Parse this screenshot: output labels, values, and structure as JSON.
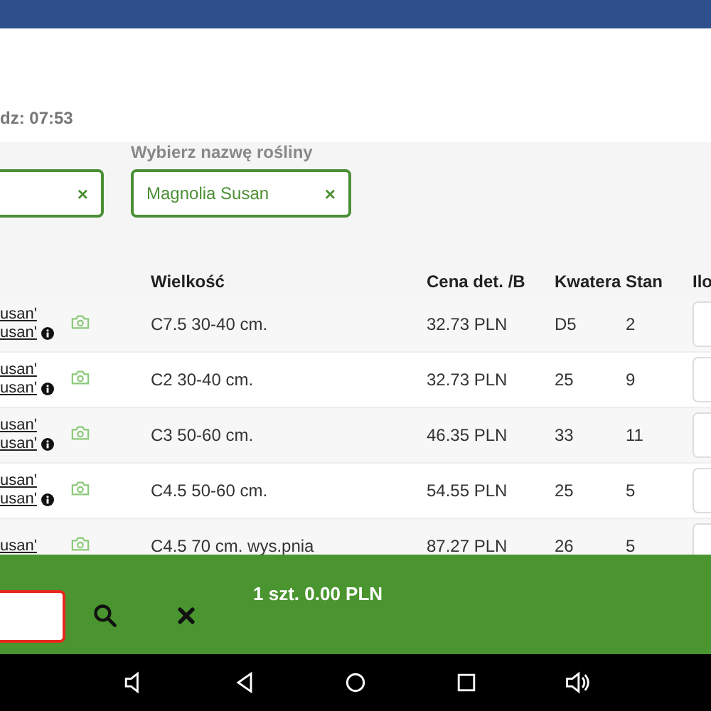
{
  "header": {
    "time_text": "dz: 07:53"
  },
  "filters": [
    {
      "clear": "×"
    },
    {
      "label": "Wybierz nazwę rośliny",
      "value": "Magnolia Susan",
      "clear": "×"
    }
  ],
  "table": {
    "columns": [
      "Wielkość",
      "Cena det. /B",
      "Kwatera",
      "Stan",
      "Ilo"
    ],
    "rows": [
      {
        "name_lines": [
          "usan'",
          "usan'"
        ],
        "size": "C7.5 30-40 cm.",
        "price": "32.73 PLN",
        "kwatera": "D5",
        "stan": "2"
      },
      {
        "name_lines": [
          "usan'",
          "usan'"
        ],
        "size": "C2 30-40 cm.",
        "price": "32.73 PLN",
        "kwatera": "25",
        "stan": "9"
      },
      {
        "name_lines": [
          "usan'",
          "usan'"
        ],
        "size": "C3 50-60 cm.",
        "price": "46.35 PLN",
        "kwatera": "33",
        "stan": "11"
      },
      {
        "name_lines": [
          "usan'",
          "usan'"
        ],
        "size": "C4.5 50-60 cm.",
        "price": "54.55 PLN",
        "kwatera": "25",
        "stan": "5"
      },
      {
        "name_lines": [
          "usan'"
        ],
        "size": "C4.5 70 cm. wys.pnia",
        "price": "87.27 PLN",
        "kwatera": "26",
        "stan": "5"
      }
    ]
  },
  "bottom_bar": {
    "summary": "1 szt. 0.00 PLN",
    "search_invalid": true
  }
}
